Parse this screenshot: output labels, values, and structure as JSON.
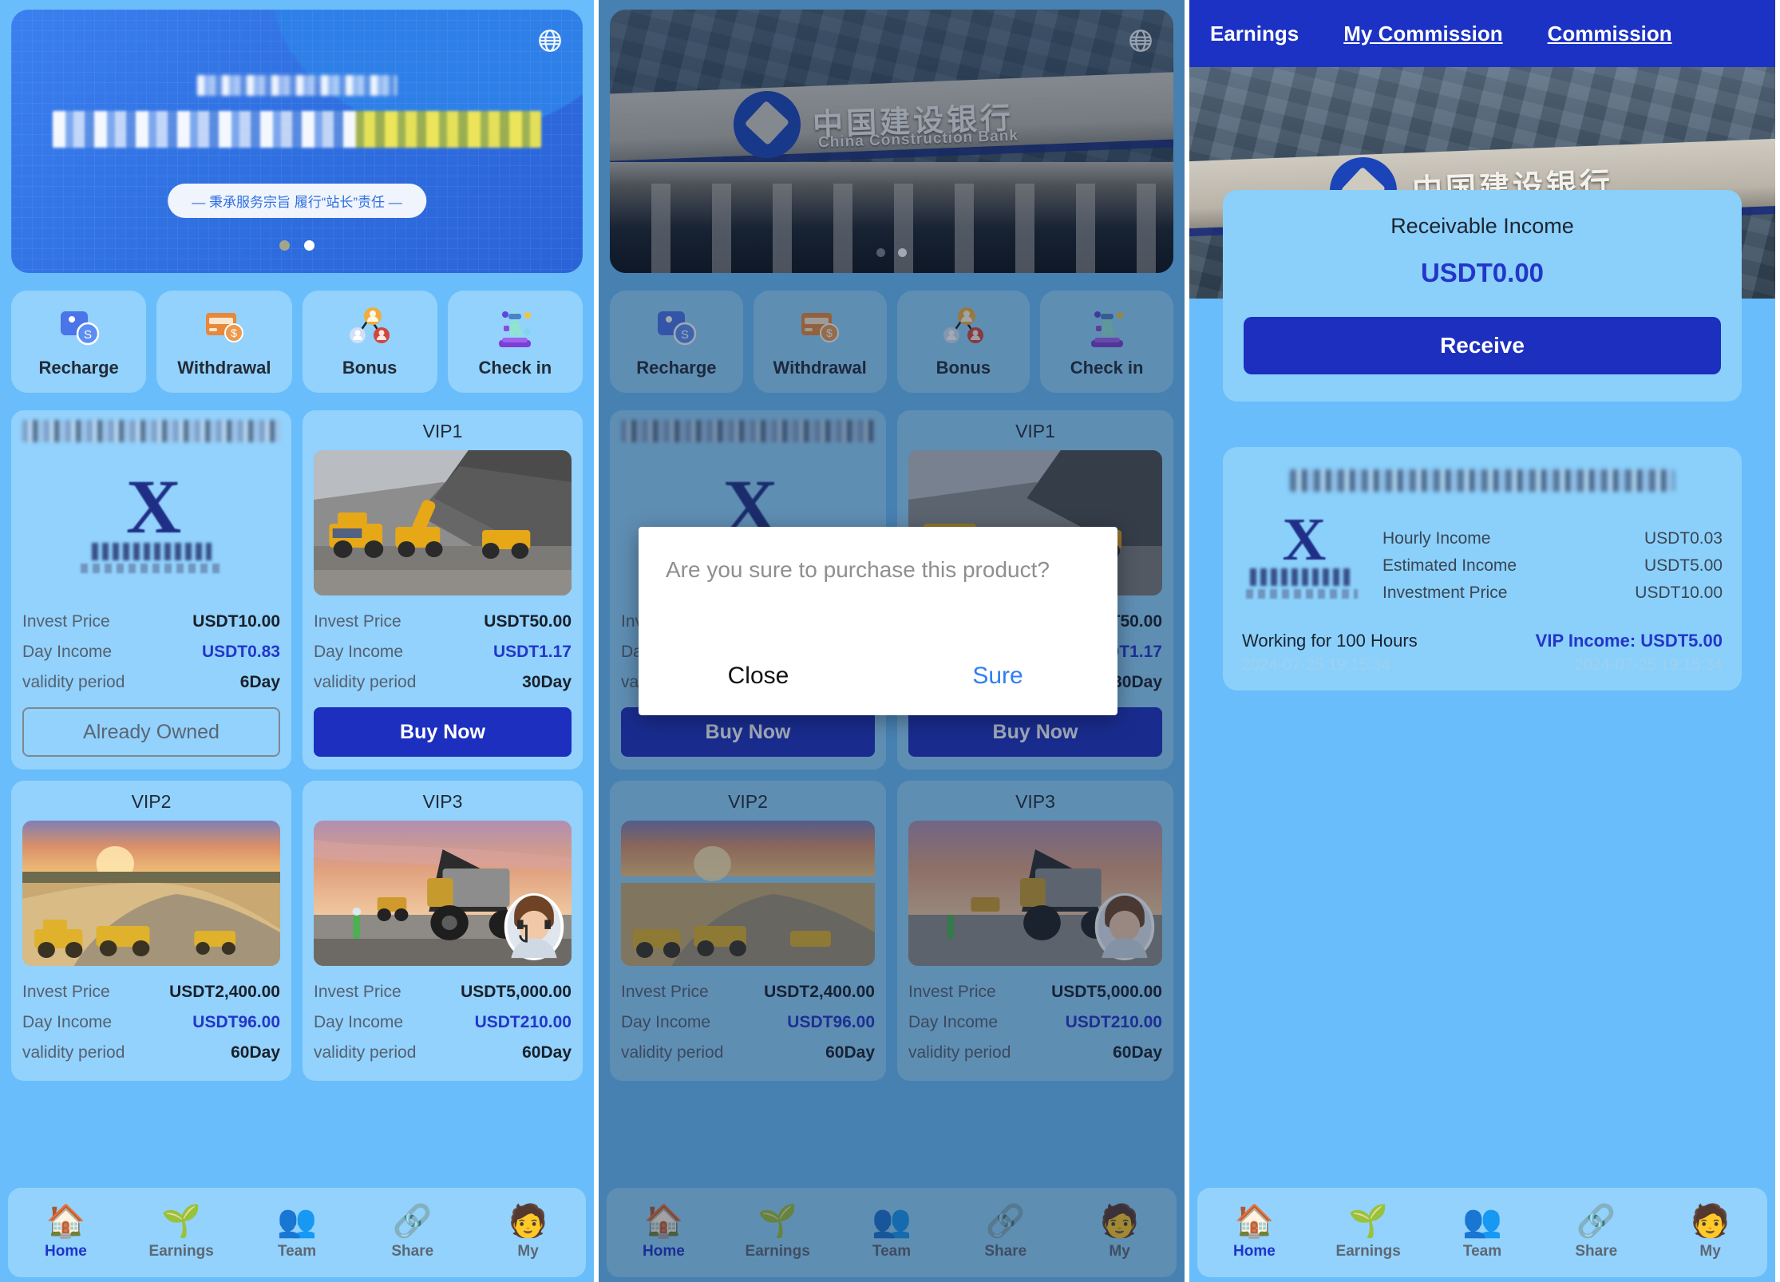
{
  "app": {
    "accent_blue": "#1d2fbe",
    "card_blue": "#92d2fc",
    "page_blue": "#69bdfb",
    "value_blue": "#2436c8"
  },
  "banner": {
    "tagline": "— 秉承服务宗旨 履行“站长”责任 —",
    "globe_icon": "globe-icon",
    "dots": 2,
    "active_dot": 2
  },
  "actions": [
    {
      "label": "Recharge",
      "icon": "wallet-dollar-icon"
    },
    {
      "label": "Withdrawal",
      "icon": "card-dollar-icon"
    },
    {
      "label": "Bonus",
      "icon": "referral-people-icon"
    },
    {
      "label": "Check in",
      "icon": "check-in-avatar-icon"
    }
  ],
  "labels": {
    "invest_price": "Invest Price",
    "day_income": "Day Income",
    "validity_period": "validity period"
  },
  "products": [
    {
      "title": "",
      "title_blurred": true,
      "image": "company-logo",
      "invest_price": "USDT10.00",
      "day_income": "USDT0.83",
      "validity_period": "6Day",
      "button": "Already Owned",
      "button_state": "owned"
    },
    {
      "title": "VIP1",
      "title_blurred": false,
      "image": "mining-trucks-grey",
      "invest_price": "USDT50.00",
      "day_income": "USDT1.17",
      "validity_period": "30Day",
      "button": "Buy Now",
      "button_state": "primary"
    },
    {
      "title": "VIP2",
      "title_blurred": false,
      "image": "mining-pit-sunset",
      "invest_price": "USDT2,400.00",
      "day_income": "USDT96.00",
      "validity_period": "60Day",
      "button": "Buy Now",
      "button_state": "primary"
    },
    {
      "title": "VIP3",
      "title_blurred": false,
      "image": "dump-truck-sunset",
      "invest_price": "USDT5,000.00",
      "day_income": "USDT210.00",
      "validity_period": "60Day",
      "button": "Buy Now",
      "button_state": "primary"
    }
  ],
  "tabbar": [
    {
      "label": "Home",
      "icon": "house-icon",
      "active": true
    },
    {
      "label": "Earnings",
      "icon": "money-plant-icon",
      "active": false
    },
    {
      "label": "Team",
      "icon": "people-group-icon",
      "active": false
    },
    {
      "label": "Share",
      "icon": "share-node-icon",
      "active": false
    },
    {
      "label": "My",
      "icon": "person-avatar-icon",
      "active": false
    }
  ],
  "bank_photo": {
    "cn_name": "中国建设银行",
    "en_name": "China Construction Bank",
    "globe_icon": "globe-icon"
  },
  "modal": {
    "message": "Are you sure to purchase this product?",
    "close_label": "Close",
    "sure_label": "Sure"
  },
  "earnings": {
    "topbar": [
      {
        "label": "Earnings",
        "underline": false
      },
      {
        "label": "My Commission",
        "underline": true
      },
      {
        "label": "Commission",
        "underline": true
      }
    ],
    "receivable": {
      "title": "Receivable Income",
      "amount": "USDT0.00",
      "button": "Receive"
    },
    "income_card": {
      "title_blurred": true,
      "rows": [
        {
          "label": "Hourly Income",
          "value": "USDT0.03"
        },
        {
          "label": "Estimated Income",
          "value": "USDT5.00"
        },
        {
          "label": "Investment Price",
          "value": "USDT10.00"
        }
      ],
      "working_text": "Working for 100 Hours",
      "working_time": "2024-07-25 19:15:34",
      "vip_income_text": "VIP Income: USDT5.00",
      "vip_income_time": "2024-07-25 19:15:34"
    }
  }
}
